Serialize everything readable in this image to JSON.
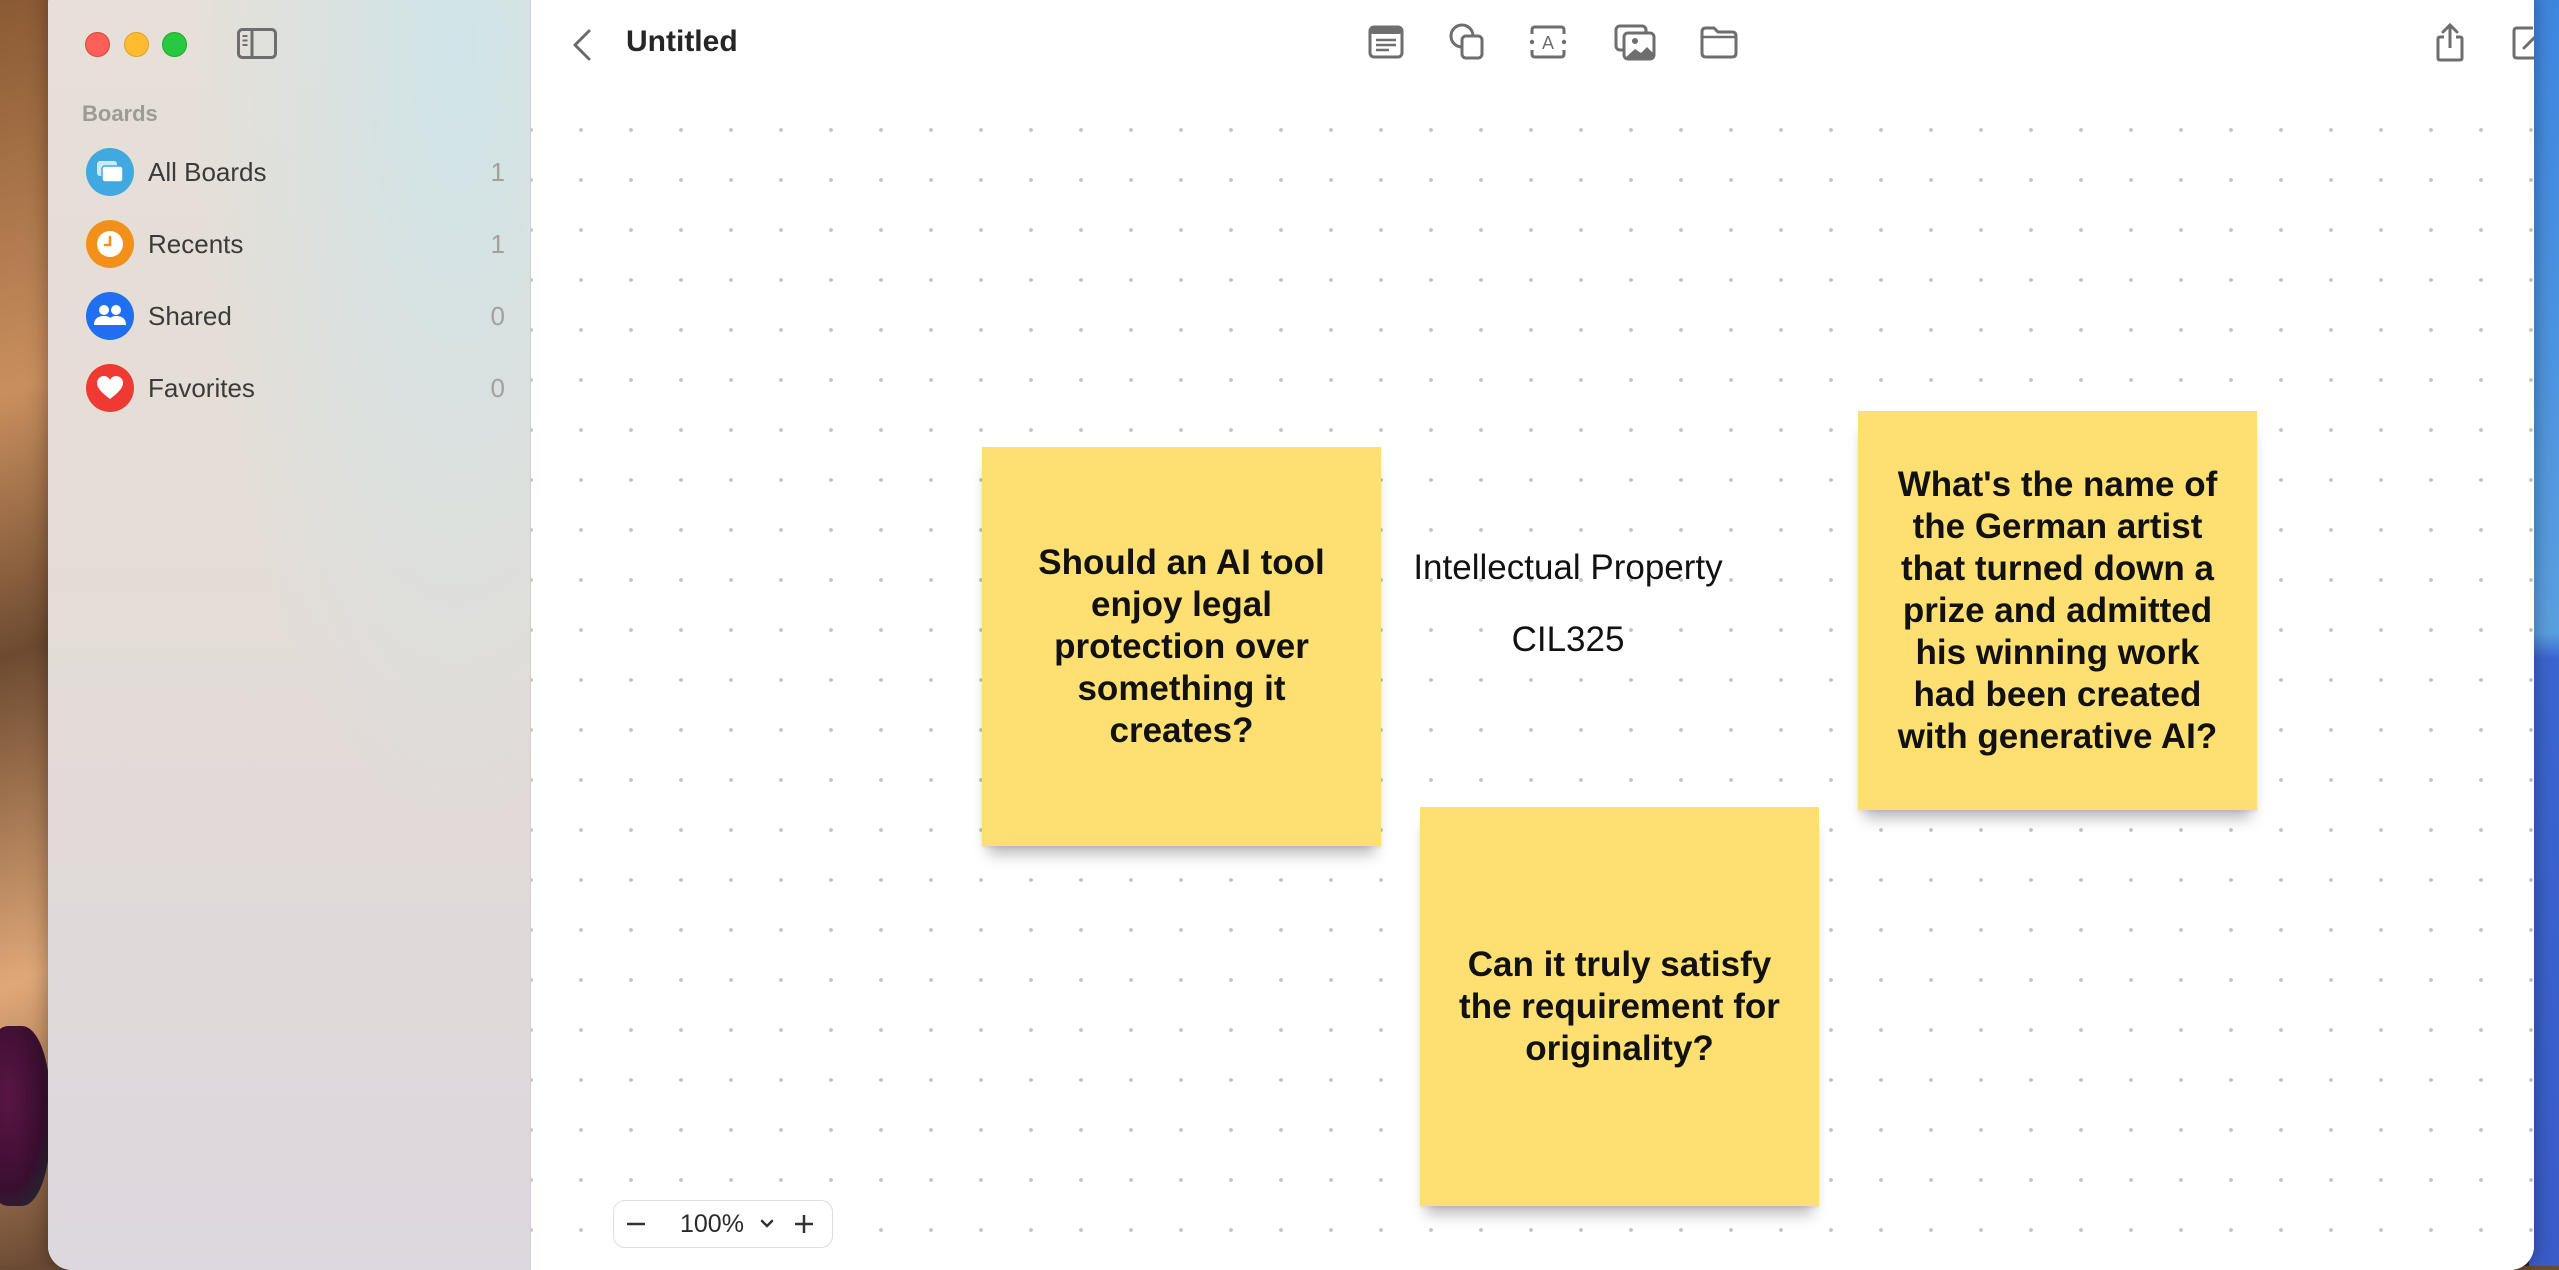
{
  "window": {
    "traffic_lights": [
      "close",
      "minimize",
      "zoom"
    ]
  },
  "sidebar": {
    "section_label": "Boards",
    "items": [
      {
        "label": "All Boards",
        "count": "1",
        "icon": "boards-stack-icon",
        "color": "#3fa9e0"
      },
      {
        "label": "Recents",
        "count": "1",
        "icon": "clock-icon",
        "color": "#f2901a"
      },
      {
        "label": "Shared",
        "count": "0",
        "icon": "people-icon",
        "color": "#1f6ff0"
      },
      {
        "label": "Favorites",
        "count": "0",
        "icon": "heart-icon",
        "color": "#ee3a32"
      }
    ]
  },
  "toolbar": {
    "title": "Untitled",
    "tools": [
      "note-icon",
      "shapes-icon",
      "text-box-icon",
      "media-icon",
      "folder-icon"
    ],
    "actions": [
      "share-icon",
      "compose-icon"
    ]
  },
  "canvas": {
    "texts": [
      {
        "text": "Intellectual Property"
      },
      {
        "text": "CIL325"
      }
    ],
    "sticky_notes": [
      {
        "text": "Should an AI tool enjoy legal protection over something it creates?",
        "color": "#fddf72"
      },
      {
        "text": "Can it truly satisfy the requirement for originality?",
        "color": "#fddf72"
      },
      {
        "text": "What's the name of the German artist that turned down a prize and admitted his winning work had been created with generative AI?",
        "color": "#fddf72"
      }
    ]
  },
  "zoom_control": {
    "value": "100%",
    "minus_label": "−",
    "plus_label": "+"
  }
}
